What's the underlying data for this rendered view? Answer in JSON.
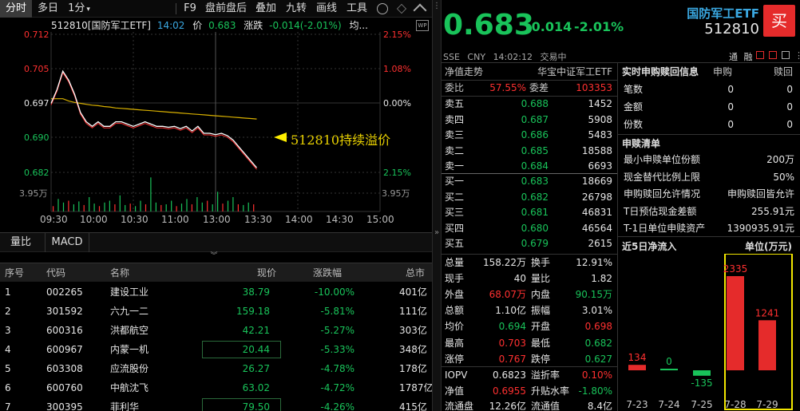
{
  "toolbar": {
    "items": [
      "分时",
      "多日",
      "1分",
      "F9",
      "盘前盘后",
      "叠加",
      "九转",
      "画线",
      "工具"
    ],
    "dropdown_arrow": "▾"
  },
  "chart": {
    "code_name": "512810[国防军工ETF]",
    "time": "14:02",
    "price_label": "价",
    "price": "0.683",
    "change_label": "涨跌",
    "change": "-0.014(-2.01%)",
    "avg_label": "均...",
    "y_left": [
      "0.712",
      "0.705",
      "0.697",
      "0.690",
      "0.682"
    ],
    "y_right": [
      "2.15%",
      "1.08%",
      "0.00%",
      "1.08%",
      "2.15%"
    ],
    "vol_left": "3.95万",
    "vol_right": "3.95万",
    "x_labels": [
      "09:30",
      "10:00",
      "10:30",
      "11:00",
      "13:00",
      "13:30",
      "14:00",
      "14:30",
      "15:00"
    ],
    "annotation": "512810持续溢价",
    "price_line": [
      0.697,
      0.7,
      0.704,
      0.702,
      0.699,
      0.695,
      0.693,
      0.692,
      0.693,
      0.692,
      0.692,
      0.693,
      0.693,
      0.6925,
      0.692,
      0.6925,
      0.693,
      0.6925,
      0.692,
      0.692,
      0.6918,
      0.692,
      0.6915,
      0.692,
      0.691,
      0.692,
      0.6905,
      0.6905,
      0.6902,
      0.6905,
      0.69,
      0.689,
      0.6875,
      0.686,
      0.6845,
      0.683
    ],
    "avg_line": [
      0.698,
      0.698,
      0.698,
      0.6975,
      0.6972,
      0.697,
      0.6968,
      0.6966,
      0.6965,
      0.6963,
      0.6962,
      0.696,
      0.6959,
      0.6958,
      0.6957,
      0.6956,
      0.6955,
      0.6954,
      0.6953,
      0.6952,
      0.6951,
      0.695,
      0.6949,
      0.6948,
      0.6947,
      0.6946,
      0.6945,
      0.6944,
      0.6943,
      0.6942,
      0.6941,
      0.694,
      0.6939,
      0.6938,
      0.6937,
      0.6936
    ],
    "volumes": [
      0.15,
      0.35,
      0.25,
      0.3,
      0.2,
      0.28,
      0.18,
      0.4,
      0.22,
      0.15,
      0.25,
      0.3,
      0.2,
      0.45,
      0.18,
      0.22,
      0.15,
      0.3,
      0.2,
      0.95,
      0.25,
      0.18,
      0.2,
      0.3,
      0.15,
      0.22,
      0.35,
      0.2,
      0.4,
      0.25,
      0.3,
      0.2,
      0.55,
      0.22,
      0.3,
      0.4,
      0.2,
      0.18,
      0.25,
      0.2
    ]
  },
  "tabs": [
    "量比",
    "MACD"
  ],
  "table": {
    "headers": [
      "序号",
      "代码",
      "名称",
      "现价",
      "涨跌幅",
      "总市"
    ],
    "rows": [
      [
        "1",
        "002265",
        "建设工业",
        "38.79",
        "-10.00%",
        "401亿"
      ],
      [
        "2",
        "301592",
        "六九一二",
        "159.18",
        "-5.81%",
        "111亿"
      ],
      [
        "3",
        "600316",
        "洪都航空",
        "42.21",
        "-5.27%",
        "303亿"
      ],
      [
        "4",
        "600967",
        "内蒙一机",
        "20.44",
        "-5.33%",
        "348亿"
      ],
      [
        "5",
        "603308",
        "应流股份",
        "26.27",
        "-4.78%",
        "178亿"
      ],
      [
        "6",
        "600760",
        "中航沈飞",
        "63.02",
        "-4.72%",
        "1787亿"
      ],
      [
        "7",
        "300395",
        "菲利华",
        "79.50",
        "-4.26%",
        "415亿"
      ]
    ]
  },
  "quote": {
    "price": "0.683",
    "change": "-0.014",
    "pct": "-2.01%",
    "name": "国防军工ETF",
    "code": "512810",
    "buy": "买",
    "exchange": "SSE",
    "currency": "CNY",
    "time": "14:02:12",
    "status": "交易中",
    "flags": [
      "通",
      "融"
    ]
  },
  "netval": {
    "label": "净值走势",
    "index": "华宝中证军工ETF"
  },
  "weibi": {
    "label1": "委比",
    "v1": "57.55%",
    "label2": "委差",
    "v2": "103353"
  },
  "asks": [
    [
      "卖五",
      "0.688",
      "1452"
    ],
    [
      "卖四",
      "0.687",
      "5908"
    ],
    [
      "卖三",
      "0.686",
      "5483"
    ],
    [
      "卖二",
      "0.685",
      "18588"
    ],
    [
      "卖一",
      "0.684",
      "6693"
    ]
  ],
  "bids": [
    [
      "买一",
      "0.683",
      "18669"
    ],
    [
      "买二",
      "0.682",
      "26798"
    ],
    [
      "买三",
      "0.681",
      "46831"
    ],
    [
      "买四",
      "0.680",
      "46564"
    ],
    [
      "买五",
      "0.679",
      "2615"
    ]
  ],
  "stats": [
    [
      "总量",
      "158.22万",
      "w",
      "换手",
      "12.91%",
      "w"
    ],
    [
      "现手",
      "40",
      "w",
      "量比",
      "1.82",
      "w"
    ],
    [
      "外盘",
      "68.07万",
      "r",
      "内盘",
      "90.15万",
      "g"
    ],
    [
      "总额",
      "1.10亿",
      "w",
      "振幅",
      "3.01%",
      "w"
    ],
    [
      "均价",
      "0.694",
      "g",
      "开盘",
      "0.698",
      "r"
    ],
    [
      "最高",
      "0.703",
      "r",
      "最低",
      "0.682",
      "g"
    ],
    [
      "涨停",
      "0.767",
      "r",
      "跌停",
      "0.627",
      "g"
    ]
  ],
  "iopv": [
    [
      "IOPV",
      "0.6823",
      "w",
      "溢折率",
      "0.10%",
      "r"
    ],
    [
      "净值",
      "0.6955",
      "r",
      "升贴水率",
      "-1.80%",
      "g"
    ],
    [
      "流通盘",
      "12.26亿",
      "w",
      "流通值",
      "8.4亿",
      "w"
    ]
  ],
  "sg": {
    "title": "实时申购赎回信息",
    "col1": "申购",
    "col2": "赎回",
    "rows": [
      [
        "笔数",
        "0",
        "0"
      ],
      [
        "金额",
        "0",
        "0"
      ],
      [
        "份数",
        "0",
        "0"
      ]
    ]
  },
  "qd": {
    "title": "申赎清单",
    "rows": [
      [
        "最小申赎单位份额",
        "200万"
      ],
      [
        "现金替代比例上限",
        "50%"
      ],
      [
        "申购赎回允许情况",
        "申购赎回皆允许"
      ],
      [
        "T日预估现金差额",
        "255.91元"
      ],
      [
        "T-1日单位申赎资产",
        "1390935.91元"
      ]
    ]
  },
  "flow": {
    "title": "近5日净流入",
    "unit": "单位(万元)",
    "dates": [
      "7-23",
      "7-24",
      "7-25",
      "7-28",
      "7-29"
    ],
    "values": [
      134,
      0,
      -135,
      2335,
      1241
    ],
    "labels": [
      "134",
      "0",
      "-135",
      "2335",
      "1241"
    ]
  }
}
